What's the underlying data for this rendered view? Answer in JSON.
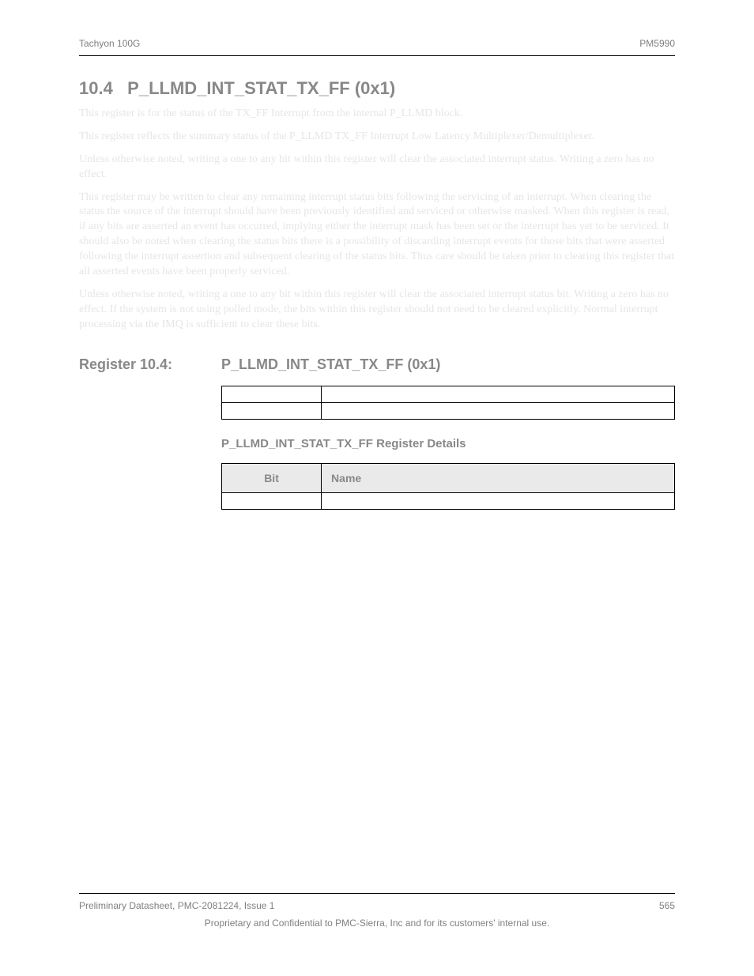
{
  "header": {
    "left": "Tachyon 100G",
    "right": "PM5990"
  },
  "section": {
    "number": "10.4",
    "title": "P_LLMD_INT_STAT_TX_FF (0x1)"
  },
  "body_top_paragraphs": [
    "This register is for the status of the TX_FF Interrupt from the internal P_LLMD block.",
    "This register reflects the summary status of the P_LLMD TX_FF Interrupt Low Latency Multiplexer/Demultiplexer.",
    "Unless otherwise noted, writing a one to any bit within this register will clear the associated interrupt status. Writing a zero has no effect.",
    "This register may be written to clear any remaining interrupt status bits following the servicing of an interrupt. When clearing the status the source of the interrupt should have been previously identified and serviced or otherwise masked. When this register is read, if any bits are asserted an event has occurred, implying either the interrupt mask has been set or the interrupt has yet to be serviced. It should also be noted when clearing the status bits there is a possibility of discarding interrupt events for those bits that were asserted following the interrupt assertion and subsequent clearing of the status bits. Thus care should be taken prior to clearing this register that all asserted events have been properly serviced.",
    "Unless otherwise noted, writing a one to any bit within this register will clear the associated interrupt status bit. Writing a zero has no effect. If the system is not using polled mode, the bits within this register should not need to be cleared explicitly. Normal interrupt processing via the IMQ is sufficient to clear these bits."
  ],
  "register_info": {
    "label": "Register 10.4:",
    "title": "P_LLMD_INT_STAT_TX_FF (0x1)"
  },
  "table1": {
    "rows": [
      {
        "bit": " ",
        "name": " "
      },
      {
        "bit": " ",
        "name": " "
      }
    ]
  },
  "table2_title": "P_LLMD_INT_STAT_TX_FF Register Details",
  "table2": {
    "headers": {
      "bit": "Bit",
      "name": "Name"
    },
    "rows": [
      {
        "bit": " ",
        "name": " "
      }
    ]
  },
  "footer": {
    "left": "Preliminary Datasheet, PMC-2081224, Issue 1",
    "center": "Proprietary and Confidential to PMC-Sierra, Inc and for its customers' internal use.",
    "right": "565"
  }
}
